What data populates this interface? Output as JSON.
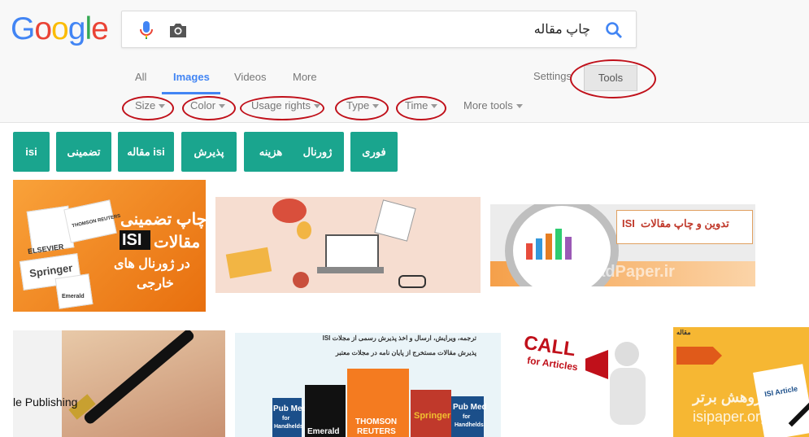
{
  "logo": {
    "text": [
      "G",
      "o",
      "o",
      "g",
      "l",
      "e"
    ],
    "colors": [
      "#4285f4",
      "#ea4335",
      "#fbbc05",
      "#4285f4",
      "#34a853",
      "#ea4335"
    ]
  },
  "search": {
    "query": "چاپ مقاله",
    "mic_icon": "mic-icon",
    "camera_icon": "camera-icon",
    "search_icon": "search-icon"
  },
  "tabs": {
    "all": "All",
    "images": "Images",
    "videos": "Videos",
    "more": "More",
    "settings": "Settings",
    "tools": "Tools"
  },
  "filters": {
    "size": "Size",
    "color": "Color",
    "usage_rights": "Usage rights",
    "type": "Type",
    "time": "Time",
    "more_tools": "More tools"
  },
  "chips": [
    "isi",
    "تضمینی",
    "مقاله isi",
    "پذیرش",
    "هزینه",
    "ژورنال",
    "فوری"
  ],
  "images": {
    "img1": {
      "line1": "چاپ تضمینی",
      "line2": "مقالات",
      "isi": "ISI",
      "line3": "در ژورنال های",
      "line4": "خارجی",
      "elsevier": "ELSEVIER",
      "thomson": "THOMSON REUTERS",
      "springer": "Springer",
      "emerald": "Emerald"
    },
    "img3": {
      "title": "تدوین و چاپ مقالات",
      "isi": "ISI",
      "watermark": "DownloadPaper.ir"
    },
    "img4": {
      "text": "le Publishing"
    },
    "img5": {
      "line1": "ترجمه، ویرایش، ارسال و اخذ پذیرش رسمی از مجلات ISI",
      "line2": "پذیرش مقالات مستخرج از پایان نامه در مجلات معتبر",
      "pubmed": "Pub Med",
      "for": "for",
      "handhelds": "Handhelds",
      "emerald": "Emerald",
      "thomson1": "THOMSON",
      "thomson2": "REUTERS",
      "springer": "Springer"
    },
    "img6": {
      "call": "CALL",
      "for": "for Articles"
    },
    "img7": {
      "title": "مقاله",
      "watermark1": "پژوهش برتر",
      "watermark2": "isipaper.org",
      "isi_article": "ISI Article"
    }
  },
  "colors": {
    "accent": "#4285f4",
    "chip": "#1aa58e",
    "annotation": "#c0101a",
    "orange": "#f28a1c"
  }
}
